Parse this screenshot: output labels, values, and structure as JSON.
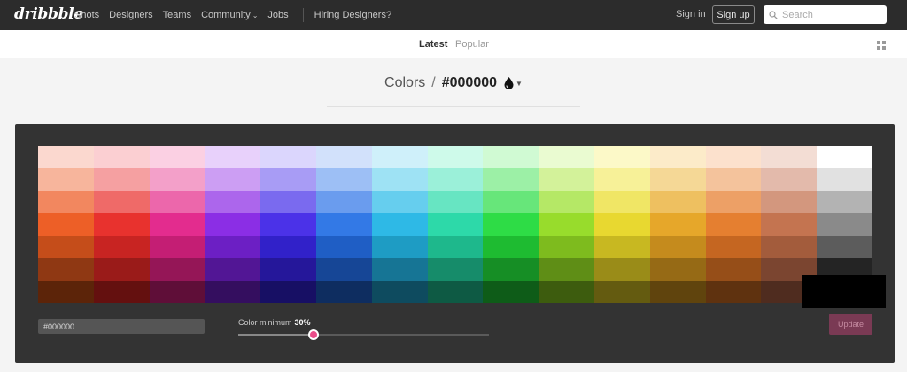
{
  "nav": {
    "logo": "dribbble",
    "links": [
      "Shots",
      "Designers",
      "Teams",
      "Community",
      "Jobs"
    ],
    "hiring": "Hiring Designers?",
    "sign_in": "Sign in",
    "sign_up": "Sign up",
    "search_placeholder": "Search"
  },
  "subnav": {
    "latest": "Latest",
    "popular": "Popular"
  },
  "title": {
    "section": "Colors",
    "separator": "/",
    "hex": "#000000"
  },
  "palette": [
    [
      "#fbd8cf",
      "#fbcfd2",
      "#fbd0e3",
      "#e8d1fb",
      "#dbd6fd",
      "#d2e1fb",
      "#cff0fa",
      "#cefaea",
      "#d0fad3",
      "#eafbd1",
      "#fcf9c8",
      "#fcebc9",
      "#fce1cd",
      "#f3ddd4",
      "#ffffff"
    ],
    [
      "#f7b59c",
      "#f5a0a1",
      "#f3a0c9",
      "#cc9ef3",
      "#a89cf5",
      "#9dbff5",
      "#9ee2f4",
      "#9bf0d9",
      "#9cf0a6",
      "#d3f29a",
      "#f7f198",
      "#f5d896",
      "#f4c39c",
      "#e3baab",
      "#e1e1e1"
    ],
    [
      "#f2875f",
      "#ef6a68",
      "#ec67ab",
      "#ac66ec",
      "#7a6aef",
      "#6a9cee",
      "#66ceee",
      "#67e5c2",
      "#67e67a",
      "#b5e866",
      "#f0e665",
      "#eec060",
      "#eda066",
      "#d3977e",
      "#b3b3b3"
    ],
    [
      "#ed5f27",
      "#e8322e",
      "#e32c8e",
      "#8b2ee5",
      "#4b32e8",
      "#3379e6",
      "#2eb9e6",
      "#2dd9a9",
      "#2edc46",
      "#98dc2c",
      "#e8d830",
      "#e6a72a",
      "#e57f30",
      "#c47450",
      "#8a8a8a"
    ],
    [
      "#c54d1a",
      "#c82422",
      "#c41e74",
      "#6c1fc4",
      "#3121c9",
      "#1f5ec5",
      "#1e9cc4",
      "#1eb88c",
      "#1ebb31",
      "#7ebb1e",
      "#c8b821",
      "#c58b1d",
      "#c56621",
      "#a35c3c",
      "#5c5c5c"
    ],
    [
      "#8f3813",
      "#9a1b19",
      "#951657",
      "#521695",
      "#25179a",
      "#164696",
      "#167595",
      "#168c6a",
      "#168e25",
      "#5f8e16",
      "#9a8c18",
      "#966a15",
      "#964e18",
      "#7b4530",
      "#242424"
    ],
    [
      "#5c2409",
      "#64100f",
      "#5f0e38",
      "#340e5f",
      "#170f64",
      "#0e2d60",
      "#0e4b5f",
      "#0e5a44",
      "#0e5c18",
      "#3d5c0e",
      "#645b10",
      "#60440d",
      "#5f320f",
      "#4f2c1f",
      "#0a0a0a"
    ]
  ],
  "selected_color": "#000000",
  "controls": {
    "hex_value": "#000000",
    "color_min_label": "Color minimum",
    "color_min_value": "30%",
    "color_min_fraction": 0.3,
    "update_label": "Update"
  }
}
